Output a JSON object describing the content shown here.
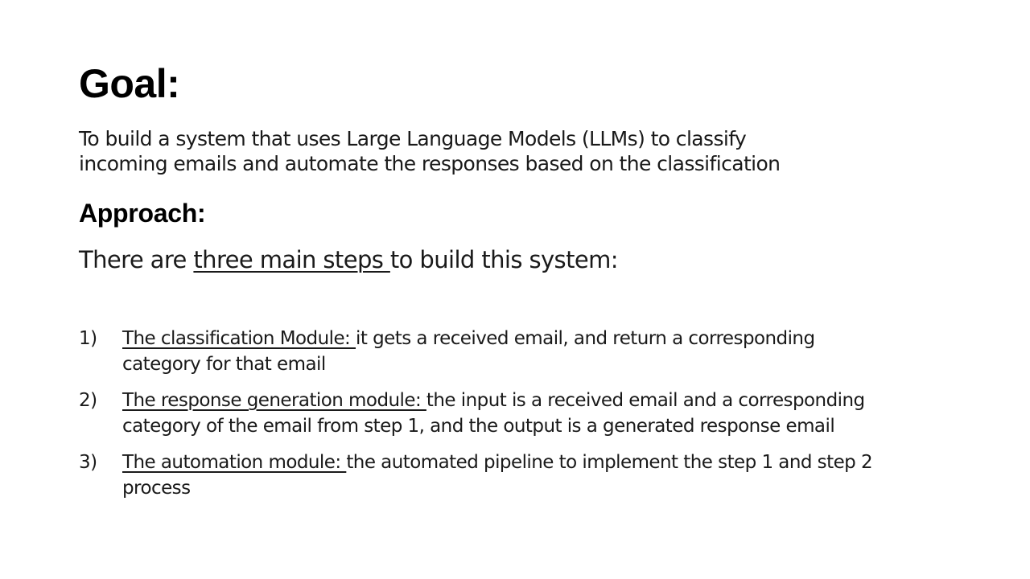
{
  "slide": {
    "goal_heading": "Goal:",
    "goal_lines": [
      "To build a system that uses Large Language Models (LLMs) to classify",
      "incoming emails and automate the responses based on the classification"
    ],
    "approach_heading": "Approach:",
    "approach_intro": {
      "before": "There are ",
      "underlined": "three main steps ",
      "after": "to build this system:"
    },
    "steps": [
      {
        "number": "1)",
        "title": "The classification Module: ",
        "line1": "it gets a received email, and return a corresponding",
        "line2": "category for that email"
      },
      {
        "number": "2)",
        "title": "The response generation module: ",
        "line1": "the input is a received email and a corresponding",
        "line2": "category of the email from step 1, and the output is a generated response email"
      },
      {
        "number": "3)",
        "title": "The automation module: ",
        "line1": "the automated pipeline to implement the step 1 and step 2",
        "line2": "process"
      }
    ]
  }
}
